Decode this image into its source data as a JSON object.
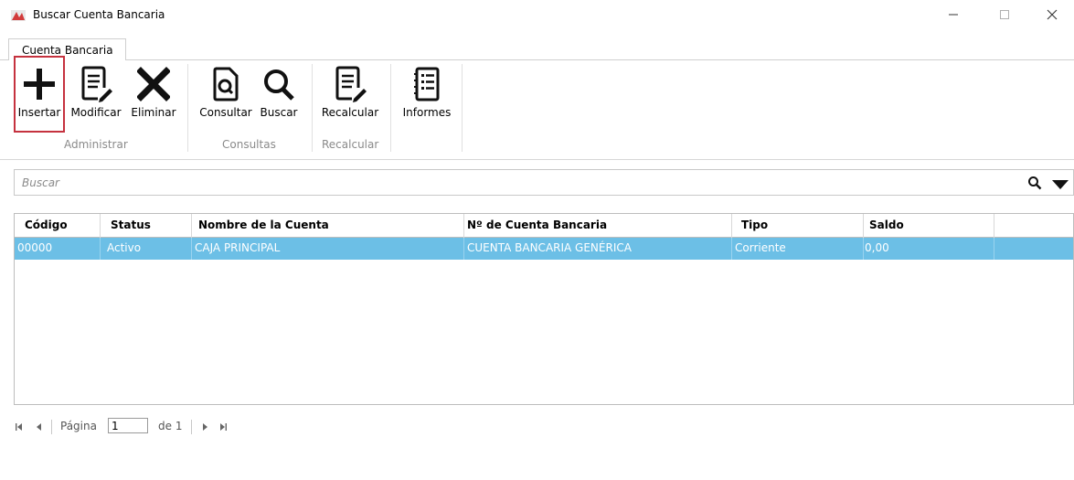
{
  "window": {
    "title": "Buscar Cuenta Bancaria"
  },
  "ribbon": {
    "tab": "Cuenta Bancaria",
    "buttons": {
      "insertar": "Insertar",
      "modificar": "Modificar",
      "eliminar": "Eliminar",
      "consultar": "Consultar",
      "buscar": "Buscar",
      "recalcular": "Recalcular",
      "informes": "Informes"
    },
    "groups": {
      "administrar": "Administrar",
      "consultas": "Consultas",
      "recalcular": "Recalcular"
    }
  },
  "search": {
    "placeholder": "Buscar"
  },
  "table": {
    "columns": [
      "Código",
      "Status",
      "Nombre de la Cuenta",
      "Nº de Cuenta Bancaria",
      "Tipo",
      "Saldo"
    ],
    "rows": [
      {
        "codigo": "00000",
        "status": "Activo",
        "nombre": "CAJA PRINCIPAL",
        "numero": "CUENTA BANCARIA GENÉRICA",
        "tipo": "Corriente",
        "saldo": "0,00"
      }
    ],
    "selected_row_color": "#6cbfe6"
  },
  "pager": {
    "page_label": "Página",
    "page_value": "1",
    "of_label": "de 1"
  },
  "icons": [
    "app-icon",
    "minimize-icon",
    "maximize-icon",
    "close-icon",
    "plus-icon",
    "edit-document-icon",
    "x-icon",
    "document-search-icon",
    "search-icon",
    "report-icon",
    "chevron-down-icon",
    "first-page-icon",
    "prev-page-icon",
    "next-page-icon",
    "last-page-icon"
  ]
}
